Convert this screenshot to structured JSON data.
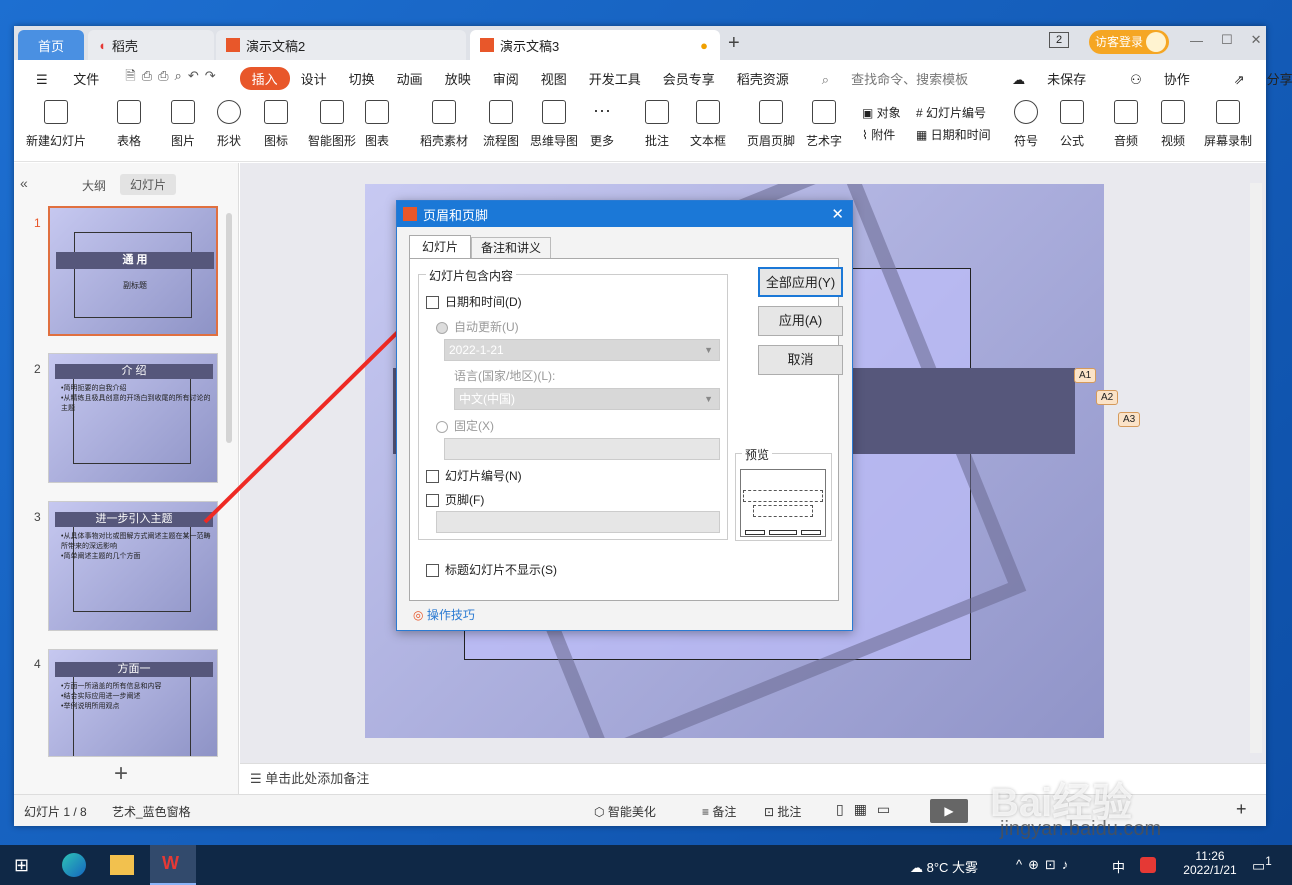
{
  "tabs": {
    "home": "首页",
    "daoke": "稻壳",
    "doc2": "演示文稿2",
    "doc3": "演示文稿3",
    "new_tab": "+"
  },
  "title_right": {
    "count": "2",
    "login": "访客登录"
  },
  "menu": {
    "hamburger": "☰",
    "file": "文件",
    "items": [
      "插入",
      "设计",
      "切换",
      "动画",
      "放映",
      "审阅",
      "视图",
      "开发工具",
      "会员专享",
      "稻壳资源"
    ],
    "active": "插入",
    "search": "查找命令、搜索模板",
    "unsaved": "未保存",
    "collab": "协作",
    "share": "分享"
  },
  "toolbar": [
    "新建幻灯片",
    "表格",
    "图片",
    "形状",
    "图标",
    "智能图形",
    "图表",
    "稻壳素材",
    "流程图",
    "思维导图",
    "更多",
    "批注",
    "文本框",
    "页眉页脚",
    "艺术字",
    "符号",
    "公式",
    "音频",
    "视频",
    "屏幕录制"
  ],
  "toolbar_small": {
    "object": "对象",
    "attach": "附件",
    "slide_no": "幻灯片编号",
    "date_time": "日期和时间"
  },
  "sidebar": {
    "outline": "大纲",
    "slides": "幻灯片",
    "add": "+"
  },
  "thumbs": [
    {
      "num": "1",
      "title": "通  用",
      "sub": "副标题"
    },
    {
      "num": "2",
      "title": "介  绍",
      "bullets": [
        "•简明扼要的自我介绍",
        "•从精练且极具创意的开场白到收尾的所有讨论的主题"
      ]
    },
    {
      "num": "3",
      "title": "进一步引入主题",
      "bullets": [
        "•从具体事物对比或图解方式阐述主题在某一范畴所带来的深远影响",
        "•简单阐述主题的几个方面"
      ]
    },
    {
      "num": "4",
      "title": "方面一",
      "bullets": [
        "•方面一所涵盖的所有信息和内容",
        "•结合实际应用进一步阐述",
        "•举例说明所用观点"
      ]
    }
  ],
  "notes": "单击此处添加备注",
  "callouts": [
    "A1",
    "A2",
    "A3"
  ],
  "dialog": {
    "title": "页眉和页脚",
    "tab_slide": "幻灯片",
    "tab_notes": "备注和讲义",
    "group": "幻灯片包含内容",
    "date_time": "日期和时间(D)",
    "auto_update": "自动更新(U)",
    "date_value": "2022-1-21",
    "language_label": "语言(国家/地区)(L):",
    "language_value": "中文(中国)",
    "fixed": "固定(X)",
    "slide_number": "幻灯片编号(N)",
    "footer": "页脚(F)",
    "no_title": "标题幻灯片不显示(S)",
    "apply_all": "全部应用(Y)",
    "apply": "应用(A)",
    "cancel": "取消",
    "preview": "预览",
    "tips": "操作技巧"
  },
  "status": {
    "slide": "幻灯片 1 / 8",
    "theme": "艺术_蓝色窗格",
    "beautify": "智能美化",
    "notes": "备注",
    "comment": "批注"
  },
  "taskbar": {
    "weather": "8°C 大雾",
    "ime": "中",
    "time": "11:26",
    "date": "2022/1/21",
    "notif": "1"
  },
  "watermark": {
    "brand": "Bai经验",
    "url": "jingyan.baidu.com"
  },
  "colors": {
    "accent": "#e8572a",
    "dialog_title": "#1b78d7",
    "slide_band": "#56577b"
  }
}
